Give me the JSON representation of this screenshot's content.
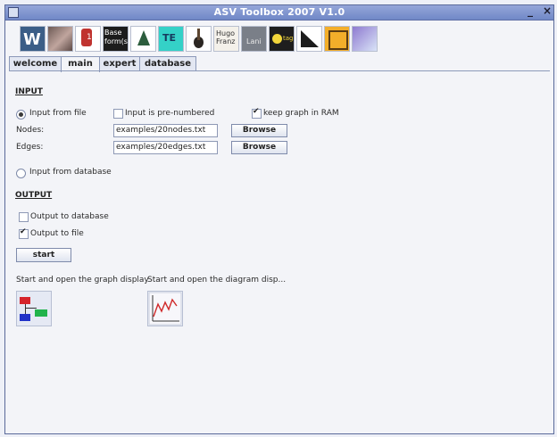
{
  "window": {
    "title": "ASV Toolbox 2007 V1.0",
    "minimize_glyph": "_",
    "close_glyph": "×"
  },
  "toolbar": {
    "icons": [
      {
        "name": "wordspace-icon"
      },
      {
        "name": "person-photo-icon"
      },
      {
        "name": "compounds-icon",
        "text": "1"
      },
      {
        "name": "baseform-icon",
        "text": "Base form(s)"
      },
      {
        "name": "tree-icon"
      },
      {
        "name": "te-icon",
        "text": "TE"
      },
      {
        "name": "guitar-icon"
      },
      {
        "name": "hugo-franz-icon",
        "text": "Hugo Franz"
      },
      {
        "name": "lani-icon",
        "text": "Lani"
      },
      {
        "name": "pacman-tag-icon",
        "text": "tag"
      },
      {
        "name": "triangle-ruler-icon"
      },
      {
        "name": "network-icon"
      },
      {
        "name": "graph-icon"
      }
    ]
  },
  "tabs": [
    "welcome",
    "main",
    "expert",
    "database"
  ],
  "main": {
    "input_header": "INPUT",
    "input_from_file": "Input from file",
    "input_pre_numbered": "Input is pre-numbered",
    "keep_graph_ram": "keep graph in RAM",
    "nodes_label": "Nodes:",
    "nodes_value": "examples/20nodes.txt",
    "edges_label": "Edges:",
    "edges_value": "examples/20edges.txt",
    "browse": "Browse",
    "input_from_database": "Input from database",
    "output_header": "OUTPUT",
    "output_to_database": "Output to database",
    "output_to_file": "Output to file",
    "start": "start",
    "graph_display_label": "Start and open the graph display",
    "diagram_display_label": "Start and open the diagram disp..."
  },
  "state": {
    "input_from_file": true,
    "input_from_database": false,
    "input_pre_numbered": false,
    "keep_graph_ram": true,
    "output_to_database": false,
    "output_to_file": true
  }
}
